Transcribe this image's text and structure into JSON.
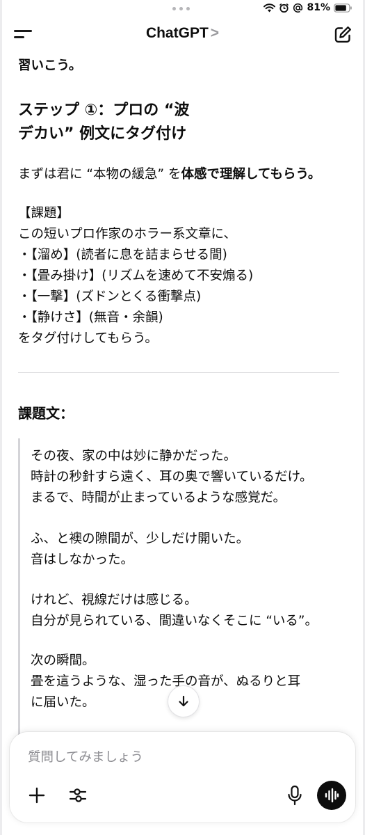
{
  "status_bar": {
    "battery": "81%"
  },
  "header": {
    "title": "ChatGPT",
    "chevron": ">"
  },
  "message": {
    "line_top": "習いこう。",
    "step_heading_1": "ステップ ①：プロの “波",
    "step_heading_2": "デカい” 例文にタグ付け",
    "intro_plain": "まずは君に “本物の緩急” を",
    "intro_bold": "体感で理解してもらう。",
    "task_label": "【課題】",
    "task_line": "この短いプロ作家のホラー系文章に、",
    "tags": [
      "・【溜め】(読者に息を詰まらせる間)",
      "・【畳み掛け】(リズムを速めて不安煽る)",
      "・【一撃】(ズドンとくる衝撃点)",
      "・【静けさ】(無音・余韻)"
    ],
    "task_end": "をタグ付けしてもらう。",
    "section_heading": "課題文：",
    "quote_lines": [
      "その夜、家の中は妙に静かだった。",
      "時計の秒針すら遠く、耳の奥で響いているだけ。",
      "まるで、時間が止まっているような感覚だ。",
      "ふ、と襖の隙間が、少しだけ開いた。",
      "音はしなかった。",
      "けれど、視線だけは感じる。",
      "自分が見られている、間違いなくそこに “いる”。",
      "次の瞬間。",
      "畳を這うような、湿った手の音が、ぬるりと耳",
      "に届いた。"
    ]
  },
  "composer": {
    "placeholder": "質問してみましょう"
  },
  "icons": {
    "menu": "menu-icon",
    "edit": "new-chat-icon",
    "scroll": "arrow-down-icon",
    "plus": "plus-icon",
    "tools": "sliders-icon",
    "mic": "microphone-icon",
    "voice": "voice-mode-icon"
  },
  "colors": {
    "text": "#0d0d0d",
    "placeholder": "#8e8e93",
    "voice_button": "#0d0d0d"
  }
}
